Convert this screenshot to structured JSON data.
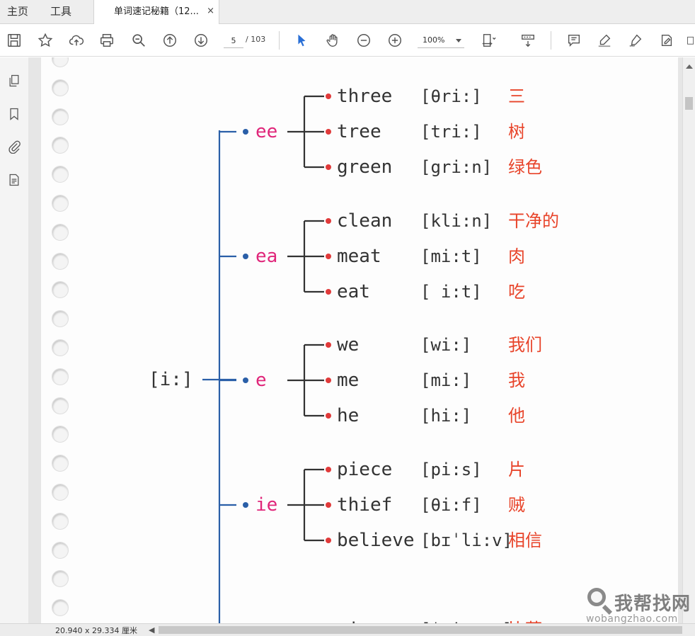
{
  "tabs": [
    {
      "label": "主页"
    },
    {
      "label": "工具"
    }
  ],
  "document_tab": {
    "label": "单词速记秘籍（12...",
    "close": "×"
  },
  "toolbar": {
    "page_current": "5",
    "page_total": "/ 103",
    "zoom": "100%"
  },
  "status": {
    "dimensions": "20.940 x 29.334 厘米"
  },
  "doc": {
    "root": "[i:]",
    "groups": [
      {
        "pattern": "ee",
        "words": [
          {
            "word": "three",
            "ipa": "[θri:]",
            "meaning": "三"
          },
          {
            "word": "tree",
            "ipa": "[tri:]",
            "meaning": "树"
          },
          {
            "word": "green",
            "ipa": "[gri:n]",
            "meaning": "绿色"
          }
        ]
      },
      {
        "pattern": "ea",
        "words": [
          {
            "word": "clean",
            "ipa": "[kli:n]",
            "meaning": "干净的"
          },
          {
            "word": "meat",
            "ipa": "[mi:t]",
            "meaning": "肉"
          },
          {
            "word": "eat",
            "ipa": "[ i:t]",
            "meaning": "吃"
          }
        ]
      },
      {
        "pattern": "e",
        "words": [
          {
            "word": "we",
            "ipa": "[wi:]",
            "meaning": "我们"
          },
          {
            "word": "me",
            "ipa": "[mi:]",
            "meaning": "我"
          },
          {
            "word": "he",
            "ipa": "[hi:]",
            "meaning": "他"
          }
        ]
      },
      {
        "pattern": "ie",
        "words": [
          {
            "word": "piece",
            "ipa": "[pi:s]",
            "meaning": "片"
          },
          {
            "word": "thief",
            "ipa": "[θi:f]",
            "meaning": "贼"
          },
          {
            "word": "believe",
            "ipa": "[bɪˈli:v]",
            "meaning": "相信"
          }
        ]
      },
      {
        "pattern": "",
        "words": [
          {
            "word": "pizza",
            "ipa": "[ˈpi:tsə]",
            "meaning": "比萨"
          }
        ]
      }
    ]
  },
  "watermark": {
    "cn": "我帮找网",
    "en": "wobangzhao.com"
  },
  "colors": {
    "tree_line": "#2a5fa8",
    "dot_pattern": "#2a5fa8",
    "dot_word": "#e03a3a",
    "pattern_text": "#e0267a",
    "meaning_text": "#e8442a",
    "bracket_line": "#333333",
    "select_tool": "#2a6fd6"
  }
}
